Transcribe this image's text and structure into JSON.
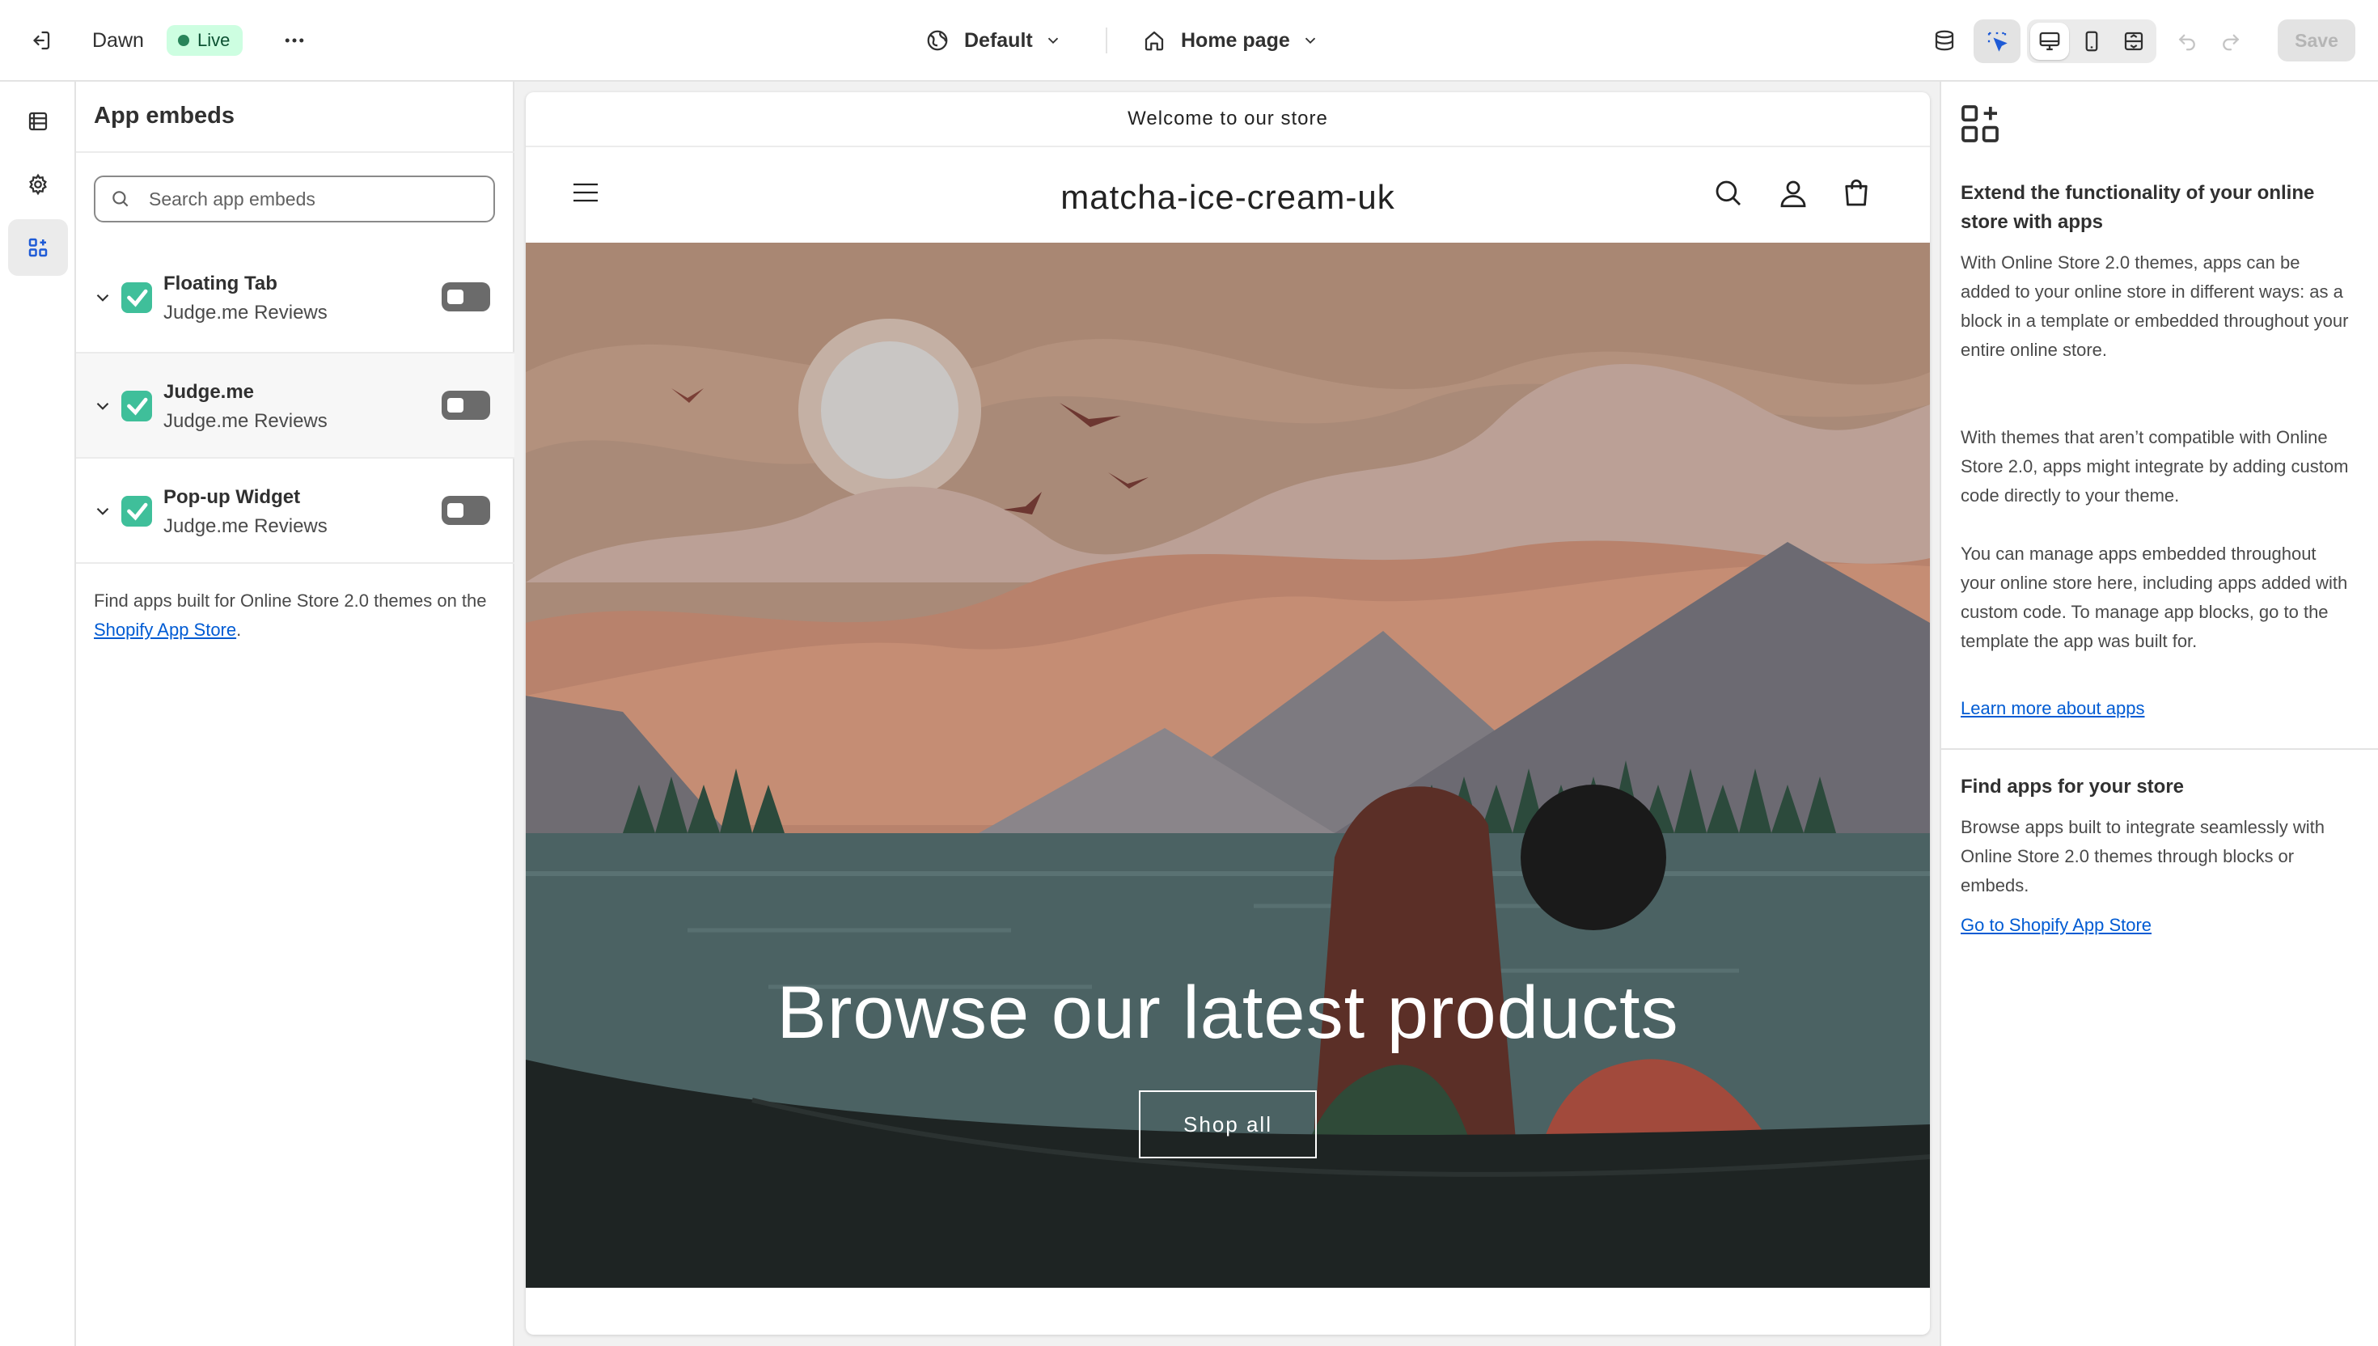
{
  "topbar": {
    "theme_name": "Dawn",
    "status_badge": "Live",
    "template_label": "Default",
    "page_label": "Home page",
    "save_label": "Save"
  },
  "sidebar": {
    "title": "App embeds",
    "search_placeholder": "Search app embeds",
    "embeds": [
      {
        "name": "Floating Tab",
        "provider": "Judge.me Reviews",
        "enabled": false
      },
      {
        "name": "Judge.me",
        "provider": "Judge.me Reviews",
        "enabled": false
      },
      {
        "name": "Pop-up Widget",
        "provider": "Judge.me Reviews",
        "enabled": false
      }
    ],
    "footer_text": "Find apps built for Online Store 2.0 themes on the ",
    "footer_link": "Shopify App Store",
    "footer_end": "."
  },
  "preview": {
    "announcement": "Welcome to our store",
    "store_name": "matcha-ice-cream-uk",
    "hero_heading": "Browse our latest products",
    "hero_button": "Shop all"
  },
  "help": {
    "heading": "Extend the functionality of your online store with apps",
    "p1": "With Online Store 2.0 themes, apps can be added to your online store in different ways: as a block in a template or embedded throughout your entire online store.",
    "p2": "With themes that aren’t compatible with Online Store 2.0, apps might integrate by adding custom code directly to your theme.",
    "p3": "You can manage apps embedded throughout your online store here, including apps added with custom code. To manage app blocks, go to the template the app was built for.",
    "link1": "Learn more about apps",
    "heading2": "Find apps for your store",
    "p4": "Browse apps built to integrate seamlessly with Online Store 2.0 themes through blocks or embeds.",
    "link2": "Go to Shopify App Store"
  },
  "colors": {
    "accent": "#005bd3",
    "live_badge_bg": "#cdfee1",
    "app_logo": "#3fbf9a"
  }
}
